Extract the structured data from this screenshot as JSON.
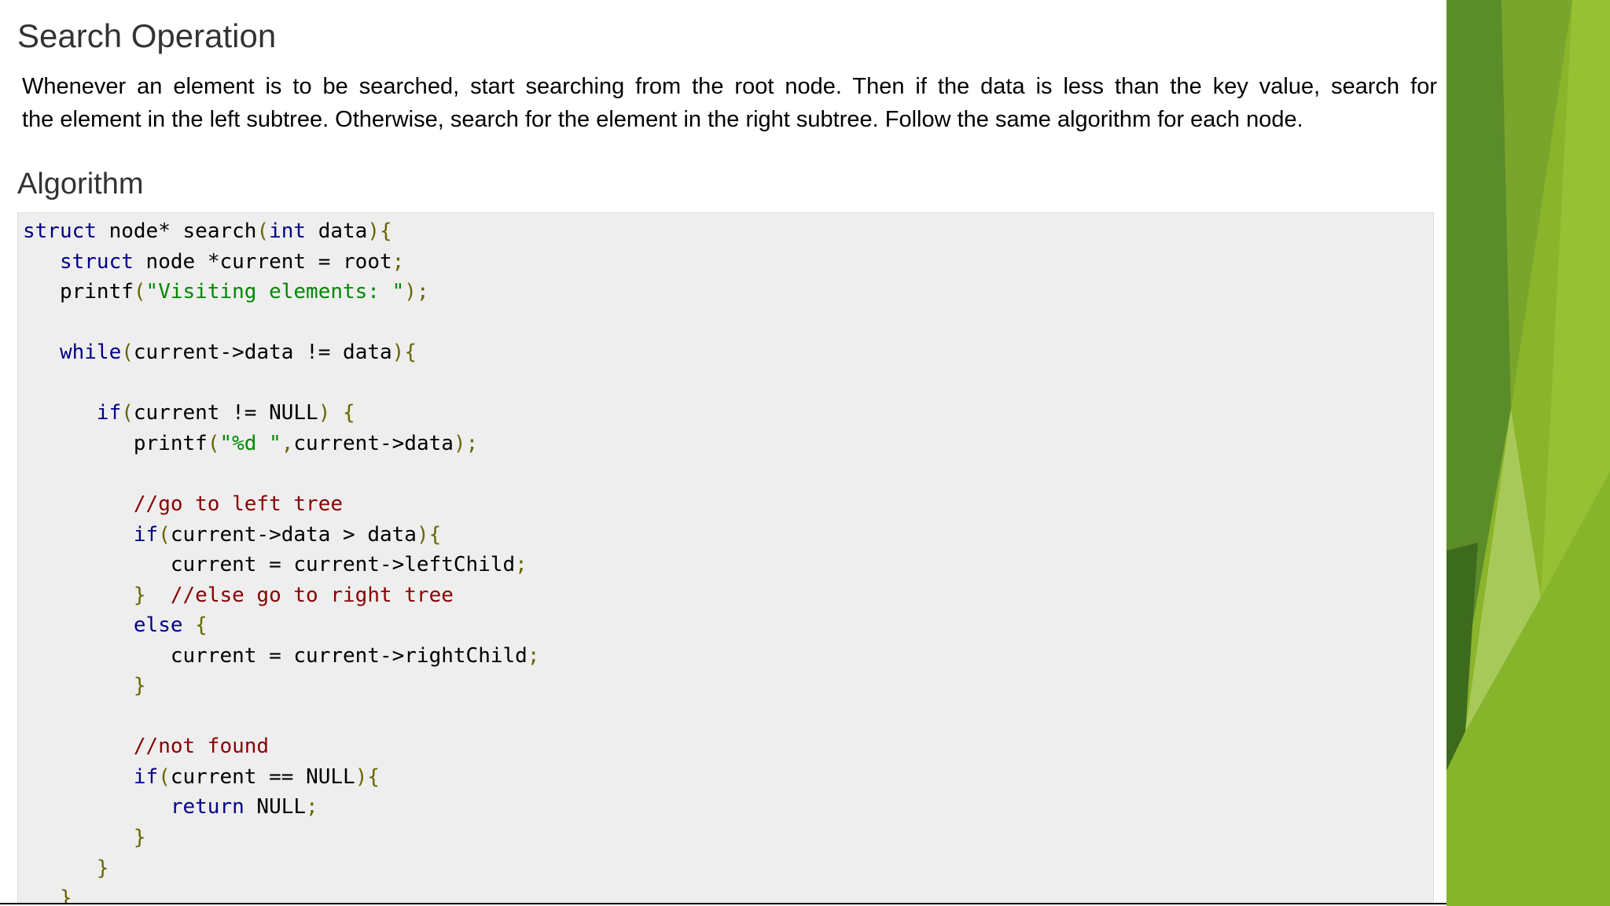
{
  "slide": {
    "heading": "Search Operation",
    "intro_lines": [
      "Whenever an element is to be searched, start searching from the root node. Then if the data is less than the key value, search for",
      "the element in the left subtree. Otherwise, search for the element in the right subtree. Follow the same algorithm for each node."
    ],
    "subheading": "Algorithm"
  },
  "code": {
    "lines": [
      "struct node* search(int data){",
      "   struct node *current = root;",
      "   printf(\"Visiting elements: \");",
      "",
      "   while(current->data != data){",
      "",
      "      if(current != NULL) {",
      "         printf(\"%d \",current->data);",
      "",
      "         //go to left tree",
      "         if(current->data > data){",
      "            current = current->leftChild;",
      "         }  //else go to right tree",
      "         else {",
      "            current = current->rightChild;",
      "         }",
      "",
      "         //not found",
      "         if(current == NULL){",
      "            return NULL;",
      "         }",
      "      }",
      "   }"
    ]
  },
  "theme": {
    "keyword_color": "#000088",
    "string_color": "#008800",
    "comment_color": "#880000",
    "punct_color": "#666600",
    "code_bg": "#eeeeee",
    "deco_greens": [
      "#8ab42a",
      "#6e9e26",
      "#4f7e2a",
      "#a8c95a",
      "#3d6b1e"
    ]
  }
}
